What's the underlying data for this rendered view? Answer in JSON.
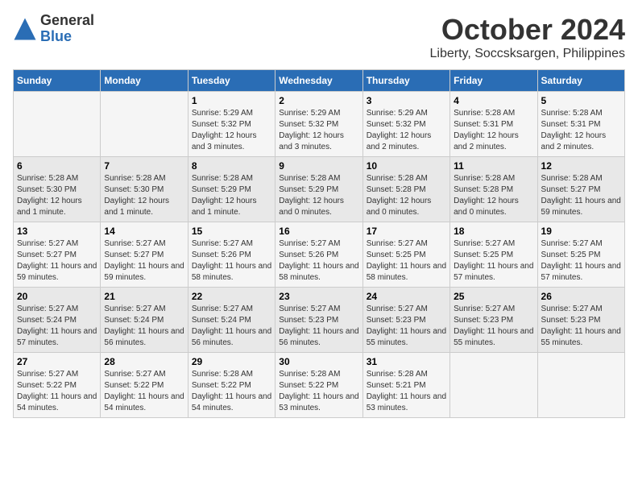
{
  "header": {
    "logo_general": "General",
    "logo_blue": "Blue",
    "month_title": "October 2024",
    "location": "Liberty, Soccsksargen, Philippines"
  },
  "weekdays": [
    "Sunday",
    "Monday",
    "Tuesday",
    "Wednesday",
    "Thursday",
    "Friday",
    "Saturday"
  ],
  "weeks": [
    [
      {
        "day": "",
        "content": ""
      },
      {
        "day": "",
        "content": ""
      },
      {
        "day": "1",
        "content": "Sunrise: 5:29 AM\nSunset: 5:32 PM\nDaylight: 12 hours and 3 minutes."
      },
      {
        "day": "2",
        "content": "Sunrise: 5:29 AM\nSunset: 5:32 PM\nDaylight: 12 hours and 3 minutes."
      },
      {
        "day": "3",
        "content": "Sunrise: 5:29 AM\nSunset: 5:32 PM\nDaylight: 12 hours and 2 minutes."
      },
      {
        "day": "4",
        "content": "Sunrise: 5:28 AM\nSunset: 5:31 PM\nDaylight: 12 hours and 2 minutes."
      },
      {
        "day": "5",
        "content": "Sunrise: 5:28 AM\nSunset: 5:31 PM\nDaylight: 12 hours and 2 minutes."
      }
    ],
    [
      {
        "day": "6",
        "content": "Sunrise: 5:28 AM\nSunset: 5:30 PM\nDaylight: 12 hours and 1 minute."
      },
      {
        "day": "7",
        "content": "Sunrise: 5:28 AM\nSunset: 5:30 PM\nDaylight: 12 hours and 1 minute."
      },
      {
        "day": "8",
        "content": "Sunrise: 5:28 AM\nSunset: 5:29 PM\nDaylight: 12 hours and 1 minute."
      },
      {
        "day": "9",
        "content": "Sunrise: 5:28 AM\nSunset: 5:29 PM\nDaylight: 12 hours and 0 minutes."
      },
      {
        "day": "10",
        "content": "Sunrise: 5:28 AM\nSunset: 5:28 PM\nDaylight: 12 hours and 0 minutes."
      },
      {
        "day": "11",
        "content": "Sunrise: 5:28 AM\nSunset: 5:28 PM\nDaylight: 12 hours and 0 minutes."
      },
      {
        "day": "12",
        "content": "Sunrise: 5:28 AM\nSunset: 5:27 PM\nDaylight: 11 hours and 59 minutes."
      }
    ],
    [
      {
        "day": "13",
        "content": "Sunrise: 5:27 AM\nSunset: 5:27 PM\nDaylight: 11 hours and 59 minutes."
      },
      {
        "day": "14",
        "content": "Sunrise: 5:27 AM\nSunset: 5:27 PM\nDaylight: 11 hours and 59 minutes."
      },
      {
        "day": "15",
        "content": "Sunrise: 5:27 AM\nSunset: 5:26 PM\nDaylight: 11 hours and 58 minutes."
      },
      {
        "day": "16",
        "content": "Sunrise: 5:27 AM\nSunset: 5:26 PM\nDaylight: 11 hours and 58 minutes."
      },
      {
        "day": "17",
        "content": "Sunrise: 5:27 AM\nSunset: 5:25 PM\nDaylight: 11 hours and 58 minutes."
      },
      {
        "day": "18",
        "content": "Sunrise: 5:27 AM\nSunset: 5:25 PM\nDaylight: 11 hours and 57 minutes."
      },
      {
        "day": "19",
        "content": "Sunrise: 5:27 AM\nSunset: 5:25 PM\nDaylight: 11 hours and 57 minutes."
      }
    ],
    [
      {
        "day": "20",
        "content": "Sunrise: 5:27 AM\nSunset: 5:24 PM\nDaylight: 11 hours and 57 minutes."
      },
      {
        "day": "21",
        "content": "Sunrise: 5:27 AM\nSunset: 5:24 PM\nDaylight: 11 hours and 56 minutes."
      },
      {
        "day": "22",
        "content": "Sunrise: 5:27 AM\nSunset: 5:24 PM\nDaylight: 11 hours and 56 minutes."
      },
      {
        "day": "23",
        "content": "Sunrise: 5:27 AM\nSunset: 5:23 PM\nDaylight: 11 hours and 56 minutes."
      },
      {
        "day": "24",
        "content": "Sunrise: 5:27 AM\nSunset: 5:23 PM\nDaylight: 11 hours and 55 minutes."
      },
      {
        "day": "25",
        "content": "Sunrise: 5:27 AM\nSunset: 5:23 PM\nDaylight: 11 hours and 55 minutes."
      },
      {
        "day": "26",
        "content": "Sunrise: 5:27 AM\nSunset: 5:23 PM\nDaylight: 11 hours and 55 minutes."
      }
    ],
    [
      {
        "day": "27",
        "content": "Sunrise: 5:27 AM\nSunset: 5:22 PM\nDaylight: 11 hours and 54 minutes."
      },
      {
        "day": "28",
        "content": "Sunrise: 5:27 AM\nSunset: 5:22 PM\nDaylight: 11 hours and 54 minutes."
      },
      {
        "day": "29",
        "content": "Sunrise: 5:28 AM\nSunset: 5:22 PM\nDaylight: 11 hours and 54 minutes."
      },
      {
        "day": "30",
        "content": "Sunrise: 5:28 AM\nSunset: 5:22 PM\nDaylight: 11 hours and 53 minutes."
      },
      {
        "day": "31",
        "content": "Sunrise: 5:28 AM\nSunset: 5:21 PM\nDaylight: 11 hours and 53 minutes."
      },
      {
        "day": "",
        "content": ""
      },
      {
        "day": "",
        "content": ""
      }
    ]
  ]
}
